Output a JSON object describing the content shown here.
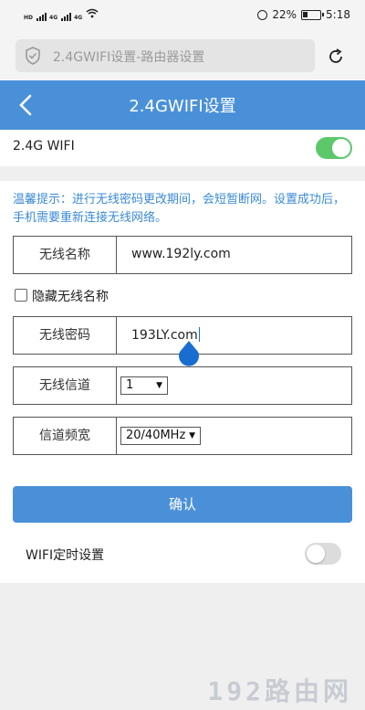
{
  "status_bar": {
    "time": "5:18",
    "battery": "22%",
    "network_tags": [
      "HD",
      "4G",
      "4G"
    ],
    "icons": [
      "signal-icon",
      "wifi-icon",
      "alarm-icon",
      "battery-icon"
    ]
  },
  "browser": {
    "url_text": "2.4GWIFI设置-路由器设置"
  },
  "header": {
    "title": "2.4GWIFI设置"
  },
  "wifi": {
    "label": "2.4G WIFI",
    "enabled": true
  },
  "hint": "温馨提示：进行无线密码更改期间，会短暂断网。设置成功后，手机需要重新连接无线网络。",
  "form": {
    "ssid_label": "无线名称",
    "ssid_value": "www.192ly.com",
    "hide_ssid_label": "隐藏无线名称",
    "hide_ssid_checked": false,
    "password_label": "无线密码",
    "password_value": "193LY.com",
    "channel_label": "无线信道",
    "channel_value": "1",
    "bandwidth_label": "信道频宽",
    "bandwidth_value": "20/40MHz"
  },
  "confirm_label": "确认",
  "wifi_timer": {
    "label": "WIFI定时设置",
    "enabled": false
  },
  "watermark": "192路由网",
  "colors": {
    "accent": "#4a90d9",
    "toggle_on": "#5cc86a",
    "hint_text": "#3a8ad6"
  }
}
